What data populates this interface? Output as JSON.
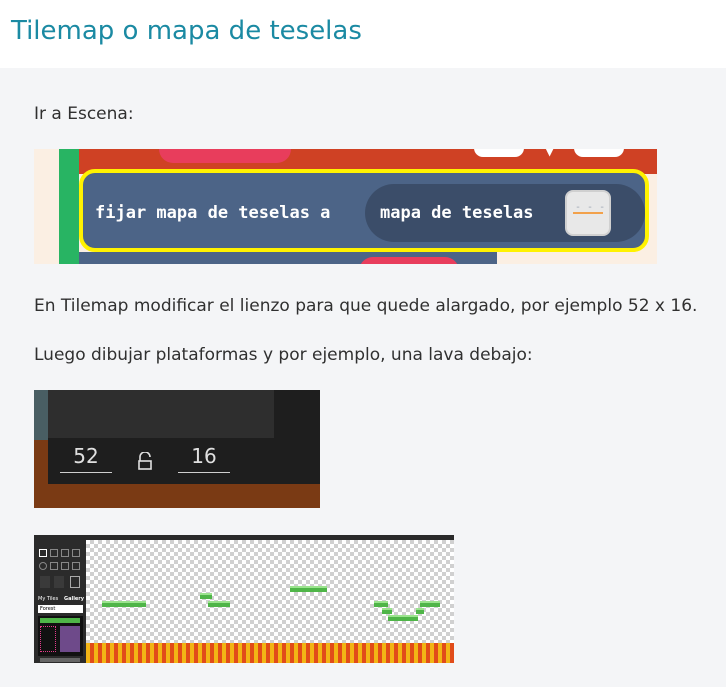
{
  "page": {
    "title": "Tilemap o mapa de teselas"
  },
  "steps": {
    "step1": "Ir a Escena:",
    "step2": "En Tilemap modificar el lienzo para que quede alargado, por ejemplo 52 x 16.",
    "step3": "Luego dibujar plataformas y por ejemplo, una lava debajo:"
  },
  "block_image": {
    "block_label": "fijar mapa de teselas a",
    "inner_label": "mapa de teselas",
    "colors": {
      "block": "#4c6487",
      "highlight": "#fff200",
      "inner": "#3b4d69"
    }
  },
  "size_image": {
    "width_value": "52",
    "height_value": "16",
    "lock_icon": "lock-icon"
  },
  "tilemap_image": {
    "tab_my_tiles": "My Tiles",
    "tab_gallery": "Gallery",
    "tileset_select": "Forest"
  }
}
